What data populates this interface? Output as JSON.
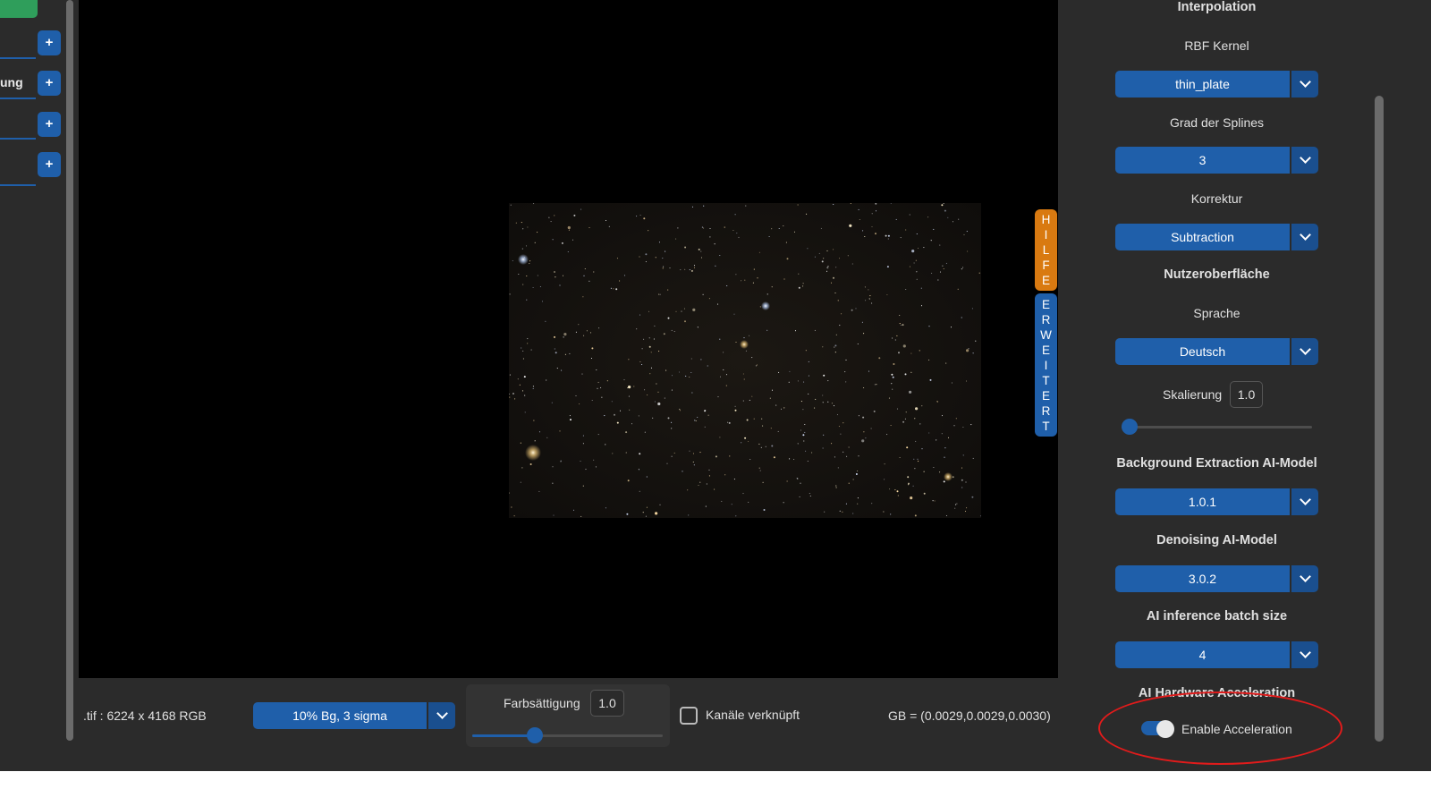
{
  "left_panel": {
    "rows": [
      {
        "label": ""
      },
      {
        "label": "ung"
      },
      {
        "label": ""
      },
      {
        "label": ""
      }
    ],
    "plus_label": "+"
  },
  "side_tabs": {
    "help_letters": [
      "H",
      "I",
      "L",
      "F",
      "E"
    ],
    "advanced_letters": [
      "E",
      "R",
      "W",
      "E",
      "I",
      "T",
      "E",
      "R",
      "T"
    ]
  },
  "bottom": {
    "file_info": ".tif : 6224 x 4168 RGB",
    "stretch_option": "10% Bg, 3 sigma",
    "saturation_label": "Farbsättigung",
    "saturation_value": "1.0",
    "saturation_slider_fraction": 0.33,
    "link_channels_label": "Kanäle verknüpft",
    "link_channels_checked": false,
    "rgb_readout": "GB = (0.0029,0.0029,0.0030)"
  },
  "right_panel": {
    "interpolation_heading": "Interpolation",
    "rbf_kernel_label": "RBF Kernel",
    "rbf_kernel_value": "thin_plate",
    "spline_degree_label": "Grad der Splines",
    "spline_degree_value": "3",
    "correction_label": "Korrektur",
    "correction_value": "Subtraction",
    "ui_heading": "Nutzeroberfläche",
    "language_label": "Sprache",
    "language_value": "Deutsch",
    "scaling_label": "Skalierung",
    "scaling_value": "1.0",
    "scaling_slider_fraction": 0.0,
    "bg_model_heading": "Background Extraction AI-Model",
    "bg_model_value": "1.0.1",
    "denoise_heading": "Denoising AI-Model",
    "denoise_value": "3.0.2",
    "batch_heading": "AI inference batch size",
    "batch_value": "4",
    "hw_heading": "AI Hardware Acceleration",
    "accel_label": "Enable Acceleration",
    "accel_enabled": true
  },
  "colors": {
    "accent": "#1f5faa",
    "help_tab": "#d97a11",
    "highlight_ellipse": "#e11b1b",
    "panel_bg": "#2b2b2b"
  }
}
